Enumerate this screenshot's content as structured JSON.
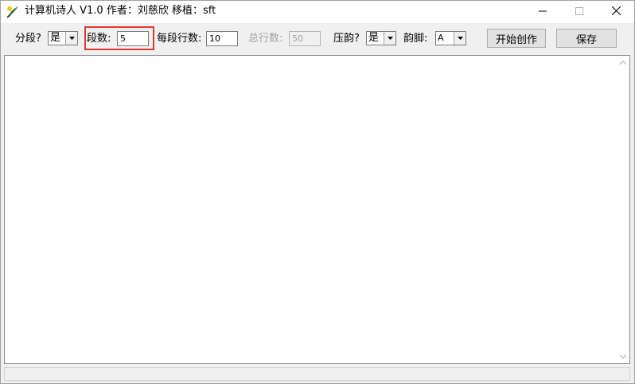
{
  "window": {
    "title": "计算机诗人 V1.0 作者：刘慈欣 移植：sft",
    "app_icon": "poet-app-icon",
    "controls": {
      "minimize": "minimize-icon",
      "maximize": "maximize-icon",
      "close": "close-icon"
    }
  },
  "toolbar": {
    "paragraph_label": "分段?",
    "paragraph_value": "是",
    "sections_label": "段数:",
    "sections_value": "5",
    "lines_per_section_label": "每段行数:",
    "lines_per_section_value": "10",
    "total_lines_label": "总行数:",
    "total_lines_value": "50",
    "rhyme_label": "压韵?",
    "rhyme_value": "是",
    "rhyme_foot_label": "韵脚:",
    "rhyme_foot_value": "A",
    "start_button": "开始创作",
    "save_button": "保存"
  },
  "editor": {
    "content": ""
  },
  "colors": {
    "highlight_box": "#e53935",
    "window_bg": "#f0f0f0",
    "editor_bg": "#ffffff"
  }
}
